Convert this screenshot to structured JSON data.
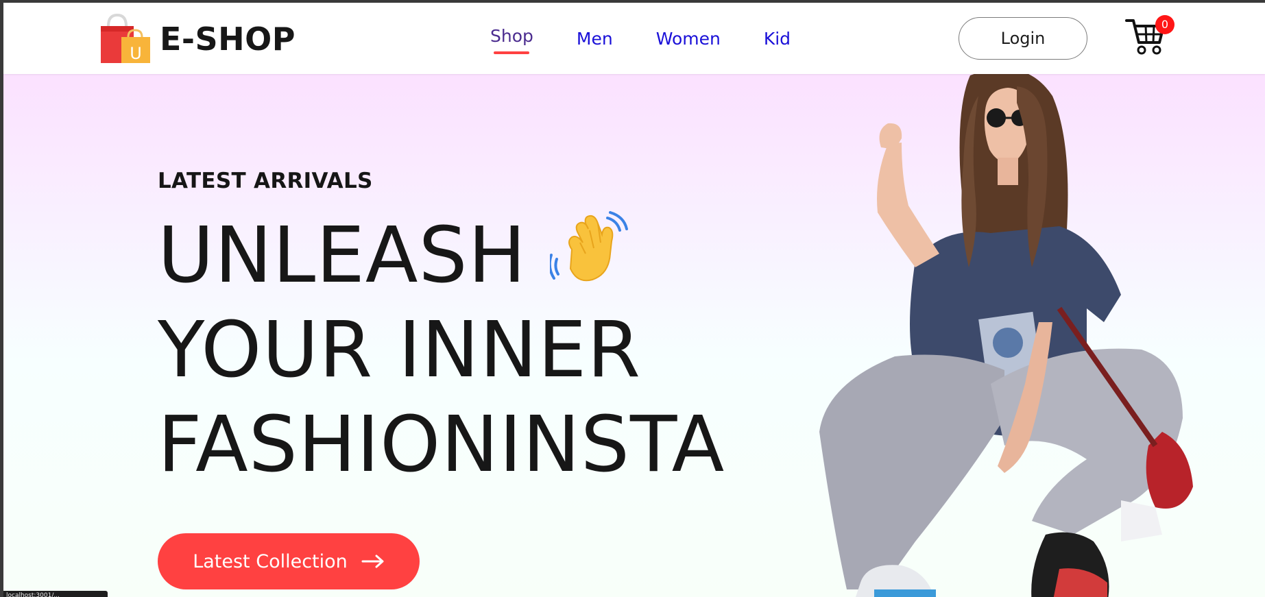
{
  "brand": {
    "name": "E-SHOP",
    "bag_letter": "U"
  },
  "nav": {
    "items": [
      {
        "label": "Shop",
        "active": true
      },
      {
        "label": "Men",
        "active": false
      },
      {
        "label": "Women",
        "active": false
      },
      {
        "label": "Kid",
        "active": false
      }
    ]
  },
  "header": {
    "login_label": "Login",
    "cart_count": "0"
  },
  "hero": {
    "kicker": "LATEST ARRIVALS",
    "title_lines": [
      "UNLEASH",
      "YOUR INNER",
      "FASHIONINSTA"
    ],
    "cta_label": "Latest Collection"
  },
  "status_bar": {
    "text": "localhost:3001/..."
  },
  "icons": {
    "logo": "shopping-bags-icon",
    "cart": "cart-icon",
    "wave": "waving-hand-icon",
    "cta_arrow": "arrow-right-icon"
  },
  "colors": {
    "accent": "#ff4141",
    "nav_link": "#1a10d8",
    "nav_active": "#4b2c8f",
    "hero_top": "#fbe1ff",
    "hero_bottom": "#f8fff9",
    "badge": "#ff1616"
  }
}
